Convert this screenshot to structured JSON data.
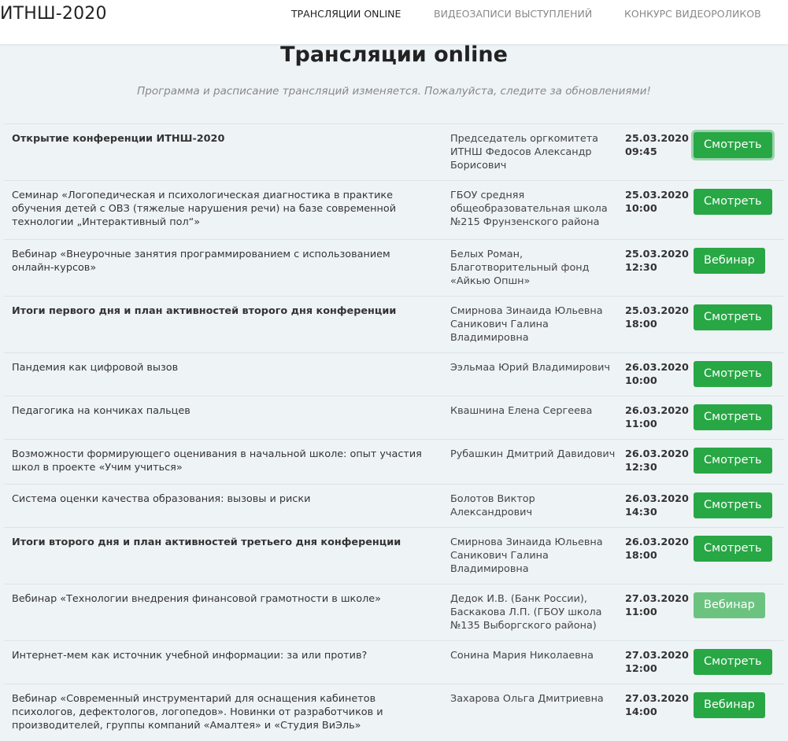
{
  "header": {
    "brand": "ИТНШ-2020",
    "nav": [
      "ТРАНСЛЯЦИИ ONLINE",
      "ВИДЕОЗАПИСИ ВЫСТУПЛЕНИЙ",
      "КОНКУРС ВИДЕОРОЛИКОВ"
    ]
  },
  "page": {
    "title": "Трансляции online",
    "subtitle": "Программа и расписание трансляций изменяется. Пожалуйста, следите за обновлениями!"
  },
  "sessions": [
    {
      "title": "Открытие конференции ИТНШ-2020",
      "author": "Председатель оргкомитета ИТНШ Федосов Александр Борисович",
      "date": "25.03.2020",
      "time": "09:45",
      "button": "Смотреть"
    },
    {
      "title": "Семинар «Логопедическая и психологическая диагностика в практике обучения детей с ОВЗ (тяжелые нарушения речи) на базе современной технологии „Интерактивный пол“»",
      "author": "ГБОУ средняя общеобразовательная школа №215 Фрунзенского района",
      "date": "25.03.2020",
      "time": "10:00",
      "button": "Смотреть"
    },
    {
      "title": "Вебинар «Внеурочные занятия программированием с использованием онлайн-курсов»",
      "author": "Белых Роман, Благотворительный фонд «Айкью Опшн»",
      "date": "25.03.2020",
      "time": "12:30",
      "button": "Вебинар"
    },
    {
      "title": "Итоги первого дня и план активностей второго дня конференции",
      "author": "Смирнова Зинаида Юльевна Саникович Галина Владимировна",
      "date": "25.03.2020",
      "time": "18:00",
      "button": "Смотреть"
    },
    {
      "title": "Пандемия как цифровой вызов",
      "author": "Ээльмаа Юрий Владимирович",
      "date": "26.03.2020",
      "time": "10:00",
      "button": "Смотреть"
    },
    {
      "title": "Педагогика на кончиках пальцев",
      "author": "Квашнина Елена Сергеева",
      "date": "26.03.2020",
      "time": "11:00",
      "button": "Смотреть"
    },
    {
      "title": "Возможности формирующего оценивания в начальной школе: опыт участия школ в проекте «Учим учиться»",
      "author": "Рубашкин Дмитрий Давидович",
      "date": "26.03.2020",
      "time": "12:30",
      "button": "Смотреть"
    },
    {
      "title": "Система оценки качества образования: вызовы и риски",
      "author": "Болотов Виктор Александрович",
      "date": "26.03.2020",
      "time": "14:30",
      "button": "Смотреть"
    },
    {
      "title": "Итоги второго дня и план активностей третьего дня конференции",
      "author": "Смирнова Зинаида Юльевна Саникович Галина Владимировна",
      "date": "26.03.2020",
      "time": "18:00",
      "button": "Смотреть"
    },
    {
      "title": "Вебинар «Технологии внедрения финансовой грамотности в школе»",
      "author": "Дедок И.В. (Банк России), Баскакова Л.П. (ГБОУ школа №135 Выборгского района)",
      "date": "27.03.2020",
      "time": "11:00",
      "button": "Вебинар"
    },
    {
      "title": "Интернет-мем как источник учебной информации: за или против?",
      "author": "Сонина Мария Николаевна",
      "date": "27.03.2020",
      "time": "12:00",
      "button": "Смотреть"
    },
    {
      "title": "Вебинар «Современный инструментарий для оснащения кабинетов психологов, дефектологов, логопедов». Новинки от разработчиков и производителей, группы компаний «Амалтея» и «Студия ВиЭль»",
      "author": "Захарова Ольга Дмитриевна",
      "date": "27.03.2020",
      "time": "14:00",
      "button": "Вебинар"
    }
  ],
  "colors": {
    "button": "#28a745",
    "button_disabled": "#6cc380",
    "background": "#eef3f6"
  }
}
